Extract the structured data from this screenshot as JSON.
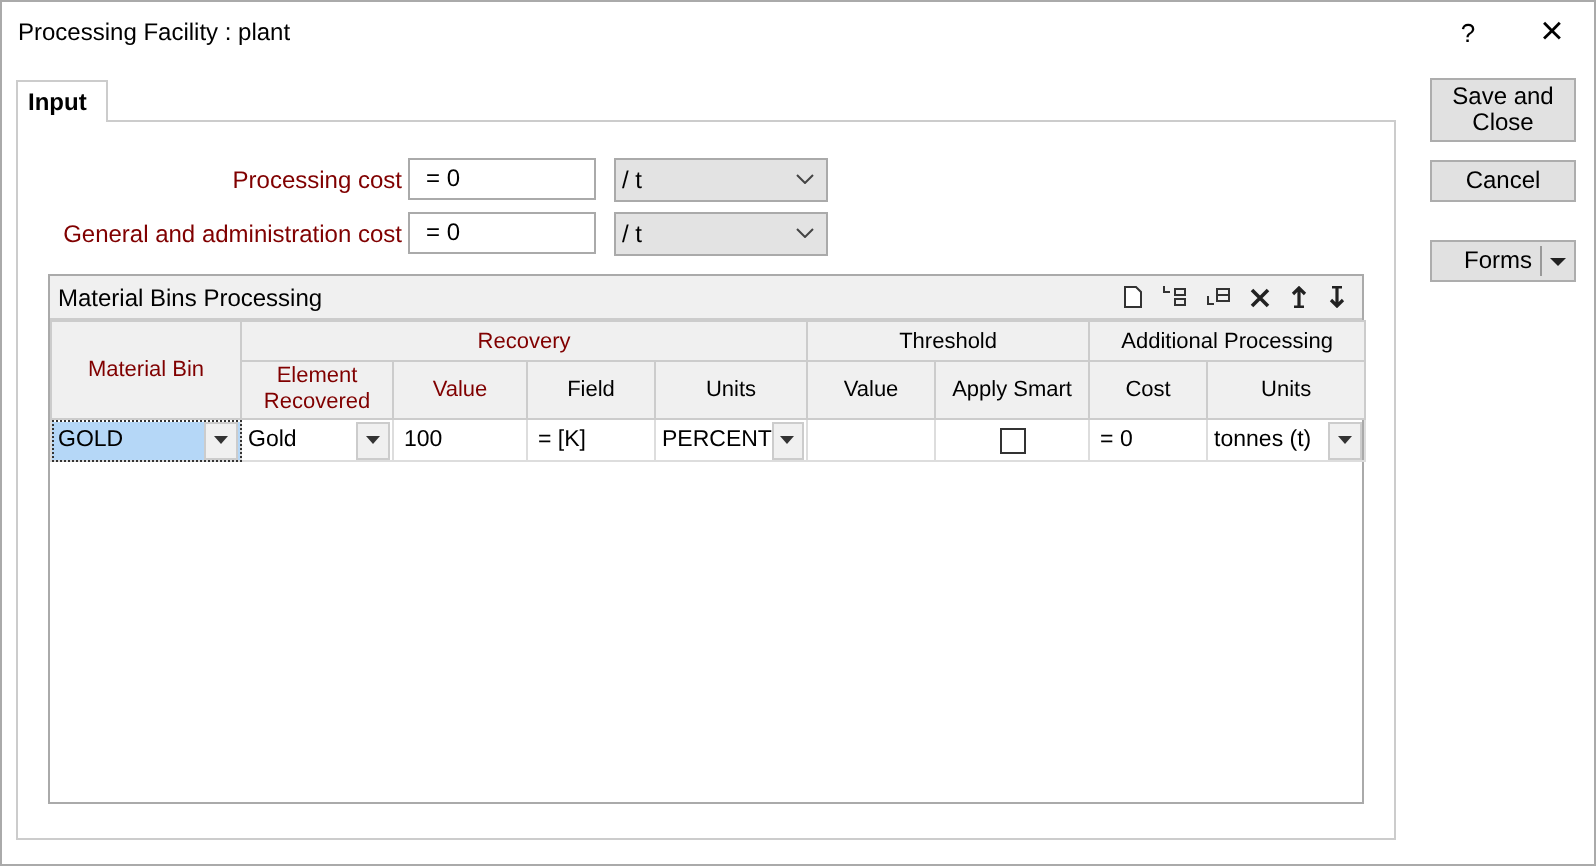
{
  "window": {
    "title": "Processing Facility : plant",
    "help": "?",
    "close": "×"
  },
  "tabs": [
    {
      "label": "Input",
      "selected": true
    }
  ],
  "fields": [
    {
      "label": "Processing cost",
      "value": "= 0",
      "unit": "/ t"
    },
    {
      "label": "General and administration cost",
      "value": "= 0",
      "unit": "/ t"
    }
  ],
  "grid": {
    "title": "Material Bins Processing",
    "groups": [
      {
        "label": "Material Bin",
        "required": true
      },
      {
        "label": "Recovery",
        "required": true,
        "columns": [
          {
            "label": "Element Recovered",
            "required": true
          },
          {
            "label": "Value",
            "required": true
          },
          {
            "label": "Field",
            "required": false
          },
          {
            "label": "Units",
            "required": false
          }
        ]
      },
      {
        "label": "Threshold",
        "required": false,
        "columns": [
          {
            "label": "Value",
            "required": false
          },
          {
            "label": "Apply Smart",
            "required": false
          }
        ]
      },
      {
        "label": "Additional Processing",
        "required": false,
        "columns": [
          {
            "label": "Cost",
            "required": false
          },
          {
            "label": "Units",
            "required": false
          }
        ]
      }
    ],
    "rows": [
      [
        {
          "kind": "combo",
          "value": "GOLD",
          "selected": true
        },
        {
          "kind": "combo",
          "value": "Gold",
          "selected": false
        },
        {
          "kind": "text",
          "value": "100",
          "selected": false
        },
        {
          "kind": "text",
          "value": "=  [K]",
          "selected": false
        },
        {
          "kind": "combo",
          "value": "PERCENT",
          "selected": false
        },
        {
          "kind": "text",
          "selected": false
        },
        {
          "kind": "checkbox",
          "checked": false,
          "selected": false
        },
        {
          "kind": "text",
          "value": "=  0",
          "selected": false
        },
        {
          "kind": "combo",
          "value": "tonnes (t)",
          "selected": false
        }
      ]
    ]
  },
  "buttons": [
    {
      "label": "Save and Close",
      "kind": "plain"
    },
    {
      "label": "Cancel",
      "kind": "plain"
    },
    {
      "label": "Forms",
      "kind": "split"
    }
  ]
}
